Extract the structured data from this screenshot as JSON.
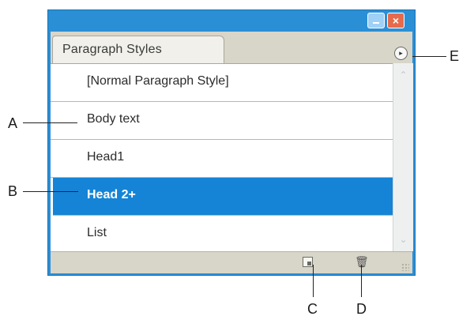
{
  "panel": {
    "tab_title": "Paragraph Styles",
    "styles": [
      "[Normal Paragraph Style]",
      "Body text",
      "Head1",
      "Head 2+",
      "List"
    ],
    "selected_index": 3
  },
  "callouts": {
    "A": "A",
    "B": "B",
    "C": "C",
    "D": "D",
    "E": "E"
  },
  "colors": {
    "window_title": "#2b8fd6",
    "selection": "#1584d7",
    "panel_bg": "#d8d5c9"
  },
  "icons": {
    "minimize": "minimize-icon",
    "close": "close-icon",
    "panel_menu": "panel-menu-icon",
    "new_style": "new-style-icon",
    "delete_style": "trash-icon",
    "resize": "resize-grip-icon"
  }
}
